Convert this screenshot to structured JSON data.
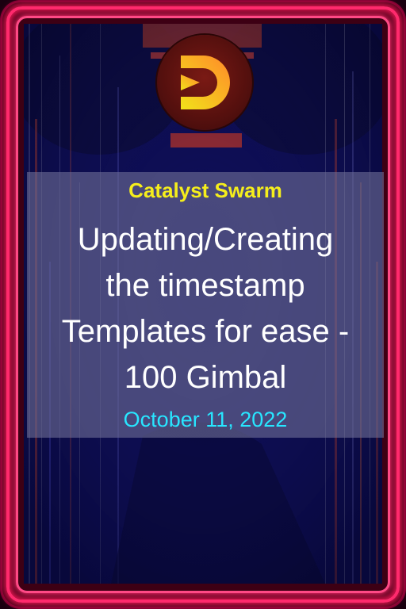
{
  "card": {
    "brand": "Catalyst Swarm",
    "title_lines": [
      "Updating/Creating",
      "the timestamp",
      "Templates for ease -",
      "100 Gimbal"
    ],
    "date": "October 11, 2022",
    "logo_icon": "gimbal-d-logo-icon"
  },
  "colors": {
    "frame": "#ff2a6d",
    "brand_text": "#f5ee1c",
    "title_text": "#ffffff",
    "date_text": "#28e6ff",
    "background": "#0c0c52"
  }
}
